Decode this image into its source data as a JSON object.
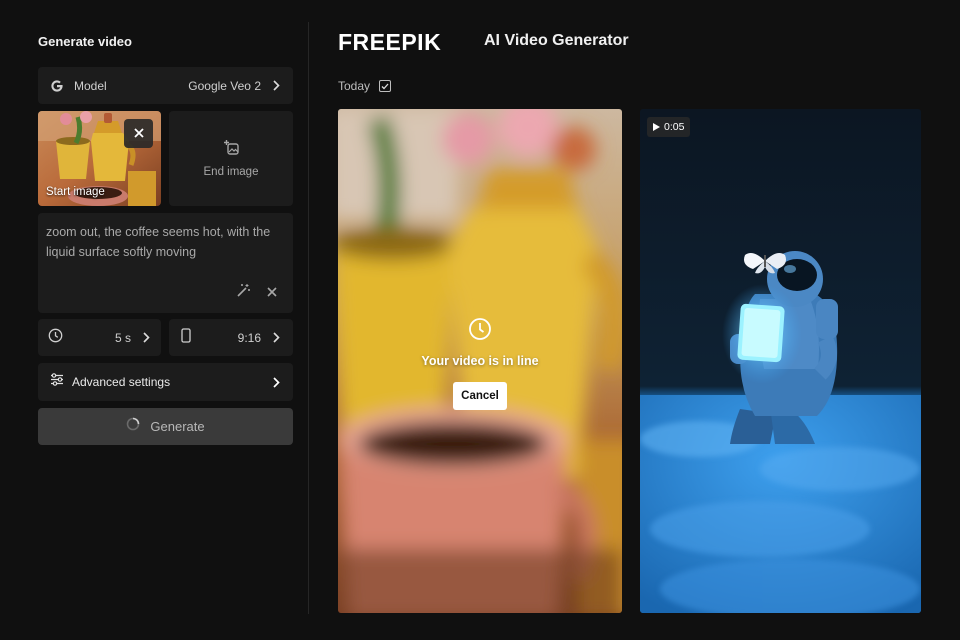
{
  "sidebar": {
    "title": "Generate video",
    "model": {
      "label": "Model",
      "value": "Google Veo 2"
    },
    "start_image": {
      "label": "Start image"
    },
    "end_image": {
      "label": "End image"
    },
    "prompt": {
      "value": "zoom out, the coffee seems hot, with the liquid surface softly moving"
    },
    "duration": {
      "value": "5 s"
    },
    "aspect_ratio": {
      "value": "9:16"
    },
    "advanced": {
      "label": "Advanced settings"
    },
    "generate": {
      "label": "Generate"
    }
  },
  "header": {
    "brand": "FREEPIK",
    "title": "AI Video Generator"
  },
  "filter": {
    "label": "Today",
    "checked": true
  },
  "videos": [
    {
      "status_text": "Your video is in line",
      "cancel_label": "Cancel"
    },
    {
      "duration": "0:05"
    }
  ],
  "colors": {
    "background": "#101010",
    "card": "#1c1c1c",
    "button_disabled": "#3a3a3a",
    "frost_blue": "#2a8fe0"
  },
  "icons": [
    "google-icon",
    "chevron-right-icon",
    "close-icon",
    "image-plus-icon",
    "magic-wand-icon",
    "clock-icon",
    "phone-icon",
    "sliders-icon",
    "spinner-icon",
    "checkbox-icon",
    "play-icon"
  ]
}
